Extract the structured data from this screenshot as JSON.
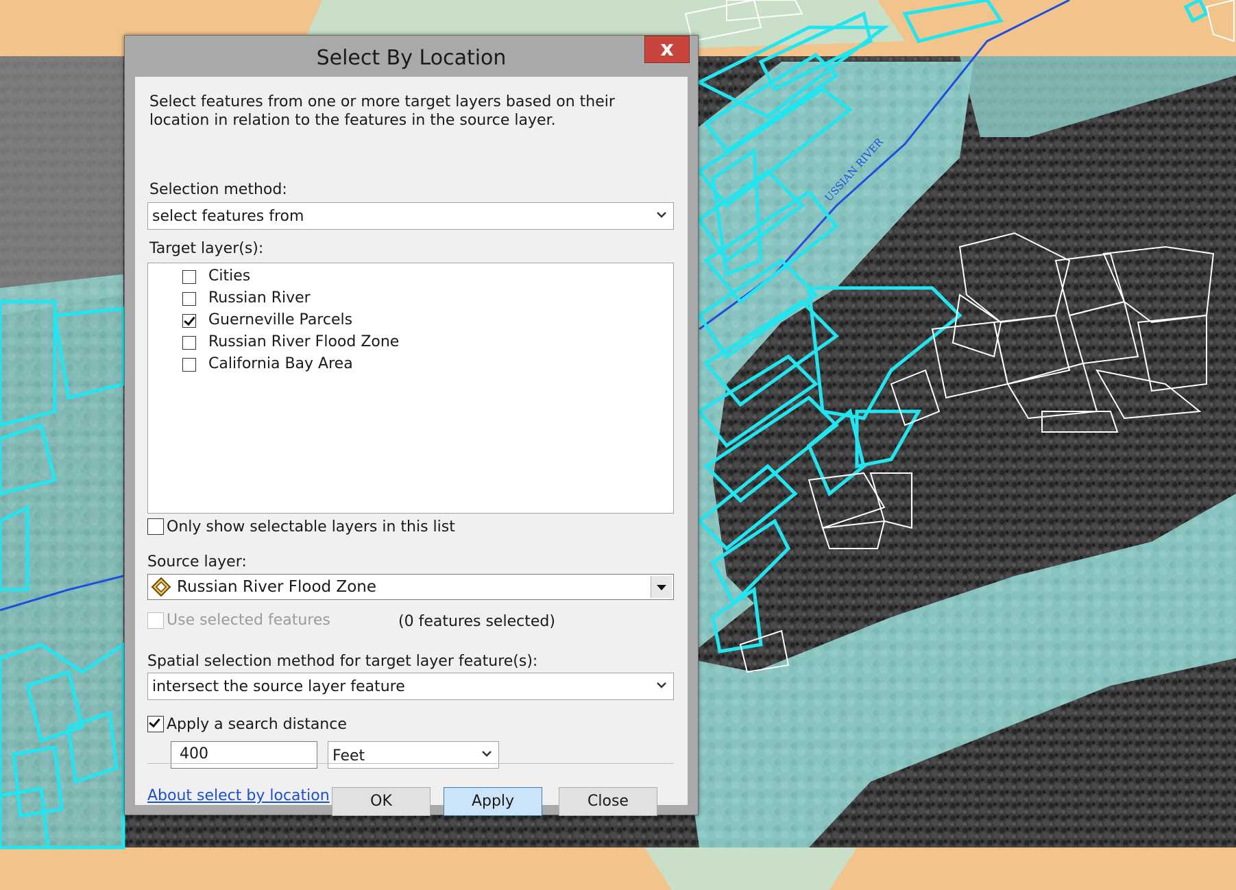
{
  "dialog": {
    "title": "Select By Location",
    "close_glyph": "x",
    "description": "Select features from one or more target layers based on their location in relation to the features in the source layer.",
    "selection_method": {
      "label": "Selection method:",
      "value": "select features from"
    },
    "target_layers": {
      "label": "Target layer(s):",
      "items": [
        {
          "label": "Cities",
          "checked": false
        },
        {
          "label": "Russian River",
          "checked": false
        },
        {
          "label": "Guerneville Parcels",
          "checked": true
        },
        {
          "label": "Russian River Flood Zone",
          "checked": false
        },
        {
          "label": "California Bay Area",
          "checked": false
        }
      ]
    },
    "only_selectable": {
      "label": "Only show selectable layers in this list",
      "checked": false
    },
    "source_layer": {
      "label": "Source layer:",
      "value": "Russian River Flood Zone",
      "icon": "polygon-layer-icon"
    },
    "use_selected": {
      "label": "Use selected features",
      "checked": false,
      "enabled": false
    },
    "features_selected": "(0 features selected)",
    "spatial_method": {
      "label": "Spatial selection method for target layer feature(s):",
      "value": "intersect the source layer feature"
    },
    "search_distance": {
      "label": "Apply a search distance",
      "checked": true,
      "value": "400",
      "unit": "Feet"
    },
    "help_link": "About select by location",
    "buttons": {
      "ok": "OK",
      "apply": "Apply",
      "close": "Close"
    }
  },
  "map": {
    "label": "USSIAN RIVER",
    "colors": {
      "highlight_parcels": "#22e5ef",
      "other_parcels": "#ffffff",
      "flood_zone": "#8fcfca",
      "land": "#f2c48b",
      "river": "#1a4fe0"
    }
  }
}
